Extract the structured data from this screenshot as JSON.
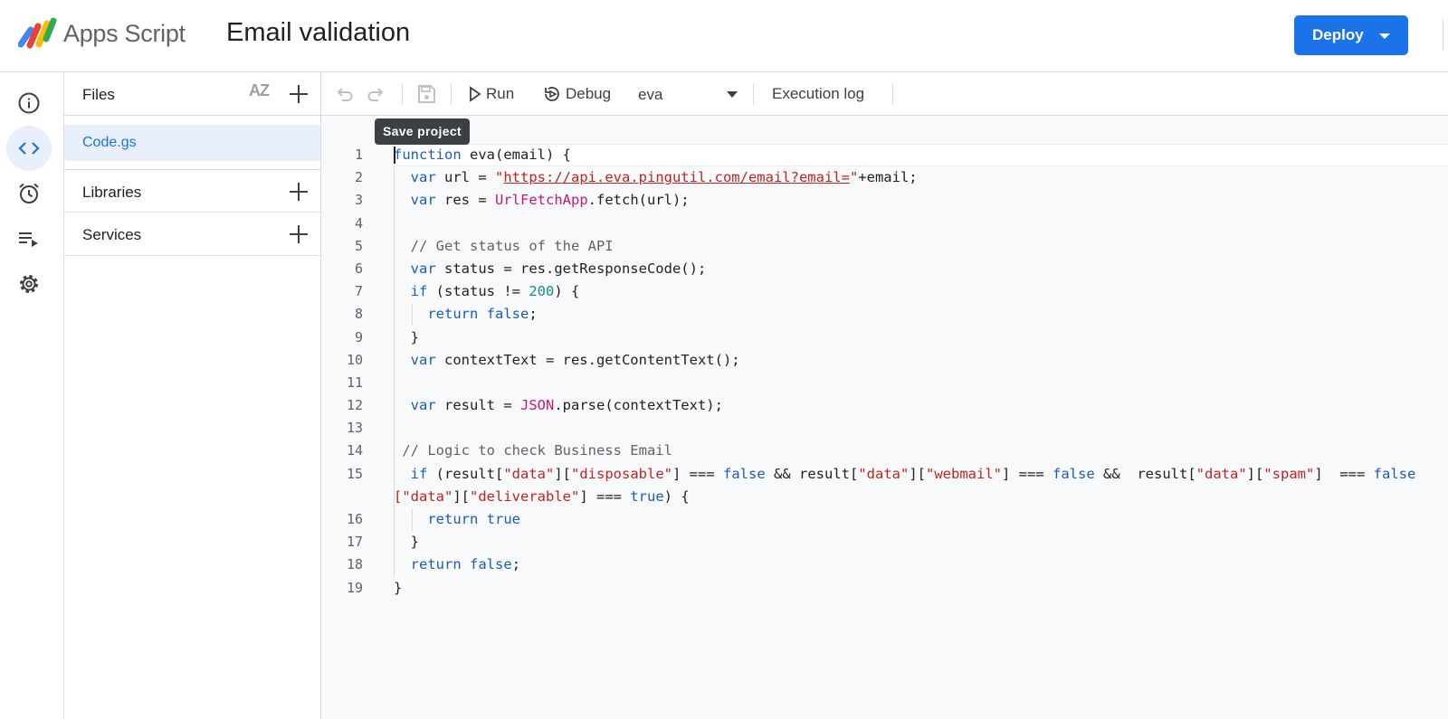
{
  "header": {
    "app_name": "Apps Script",
    "project_title": "Email validation",
    "deploy_label": "Deploy"
  },
  "rail": {
    "items": [
      {
        "icon": "info-icon",
        "label": "Overview"
      },
      {
        "icon": "code-icon",
        "label": "Editor"
      },
      {
        "icon": "alarm-clock-icon",
        "label": "Triggers"
      },
      {
        "icon": "executions-icon",
        "label": "Executions"
      },
      {
        "icon": "gear-icon",
        "label": "Project Settings"
      }
    ]
  },
  "files_panel": {
    "files_label": "Files",
    "sort_icon_label": "AZ",
    "file": "Code.gs",
    "libraries_label": "Libraries",
    "services_label": "Services"
  },
  "toolbar": {
    "run_label": "Run",
    "debug_label": "Debug",
    "function_name": "eva",
    "execution_log_label": "Execution log",
    "tooltip": "Save project"
  },
  "editor": {
    "line_numbers": [
      "1",
      "2",
      "3",
      "4",
      "5",
      "6",
      "7",
      "8",
      "9",
      "10",
      "11",
      "12",
      "13",
      "14",
      "15",
      "",
      "16",
      "17",
      "18",
      "19"
    ],
    "code": {
      "l1_kw": "function",
      "l1_rest": " eva(email) {",
      "l2_kw": "var",
      "l2_a": " url = ",
      "l2_q1": "\"",
      "l2_url": "https://api.eva.pingutil.com/email?email=",
      "l2_q2": "\"",
      "l2_b": "+email;",
      "l3_kw": "var",
      "l3_a": " res = ",
      "l3_cls": "UrlFetchApp",
      "l3_b": ".fetch(url);",
      "l5_cm": "// Get status of the API",
      "l6_kw": "var",
      "l6_rest": " status = res.getResponseCode();",
      "l7_kw": "if",
      "l7_a": " (status != ",
      "l7_num": "200",
      "l7_b": ") {",
      "l8_kw1": "return",
      "l8_kw2": "false",
      "l8_b": ";",
      "l9": "}",
      "l10_kw": "var",
      "l10_rest": " contextText = res.getContentText();",
      "l12_kw": "var",
      "l12_a": " result = ",
      "l12_cls": "JSON",
      "l12_b": ".parse(contextText);",
      "l14_cm": "// Logic to check Business Email",
      "l15_kw": "if",
      "l15_a": " (result[",
      "l15_s1": "\"data\"",
      "l15_b": "][",
      "l15_s2": "\"disposable\"",
      "l15_c": "] === ",
      "l15_f1": "false",
      "l15_d": " && result[",
      "l15_s3": "\"data\"",
      "l15_e": "][",
      "l15_s4": "\"webmail\"",
      "l15_f": "] === ",
      "l15_f2": "false",
      "l15_g": " &&  result[",
      "l15_s5": "\"data\"",
      "l15_h": "][",
      "l15_s6": "\"spam\"",
      "l15_i": "]  === ",
      "l15_f3": "false",
      "l15w_s1": "[\"data\"",
      "l15w_a": "][",
      "l15w_s2": "\"deliverable\"",
      "l15w_b": "] === ",
      "l15w_kw": "true",
      "l15w_c": ") {",
      "l16_kw1": "return",
      "l16_kw2": "true",
      "l17": "}",
      "l18_kw1": "return",
      "l18_kw2": "false",
      "l18_b": ";",
      "l19": "}"
    }
  },
  "colors": {
    "accent": "#1a73e8",
    "keyword": "#1a5bbf",
    "string": "#c5221f",
    "class": "#c4187a",
    "number": "#0f8c8c",
    "comment": "#5f6368"
  }
}
